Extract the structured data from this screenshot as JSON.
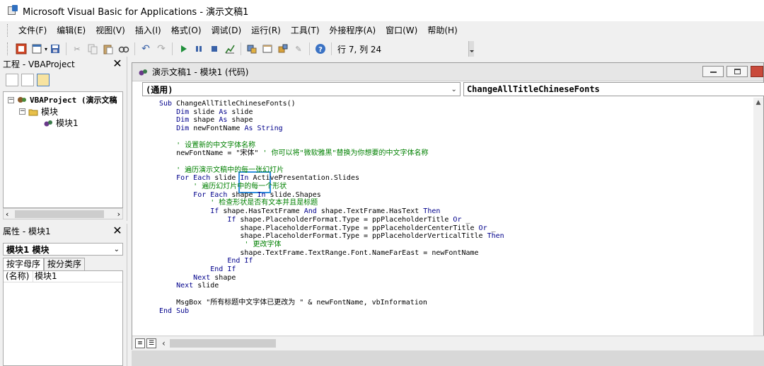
{
  "window": {
    "title": "Microsoft Visual Basic for Applications - 演示文稿1"
  },
  "menu": [
    "文件(F)",
    "编辑(E)",
    "视图(V)",
    "插入(I)",
    "格式(O)",
    "调试(D)",
    "运行(R)",
    "工具(T)",
    "外接程序(A)",
    "窗口(W)",
    "帮助(H)"
  ],
  "toolbar": {
    "status": "行 7, 列 24"
  },
  "project_panel": {
    "title": "工程 - VBAProject",
    "root": "VBAProject (演示文稿",
    "folder": "模块",
    "module": "模块1"
  },
  "properties_panel": {
    "title": "属性 - 模块1",
    "object": "模块1 模块",
    "tabs": [
      "按字母序",
      "按分类序"
    ],
    "rows": [
      {
        "key": "(名称)",
        "value": "模块1"
      }
    ]
  },
  "code_window": {
    "title": "演示文稿1 - 模块1 (代码)",
    "object_dropdown": "(通用)",
    "proc_dropdown": "ChangeAllTitleChineseFonts",
    "lines": [
      [
        [
          "kw",
          "Sub "
        ],
        [
          "t",
          "ChangeAllTitleChineseFonts()"
        ]
      ],
      [
        [
          "t",
          "    "
        ],
        [
          "kw",
          "Dim "
        ],
        [
          "t",
          "slide "
        ],
        [
          "kw",
          "As "
        ],
        [
          "t",
          "slide"
        ]
      ],
      [
        [
          "t",
          "    "
        ],
        [
          "kw",
          "Dim "
        ],
        [
          "t",
          "shape "
        ],
        [
          "kw",
          "As "
        ],
        [
          "t",
          "shape"
        ]
      ],
      [
        [
          "t",
          "    "
        ],
        [
          "kw",
          "Dim "
        ],
        [
          "t",
          "newFontName "
        ],
        [
          "kw",
          "As String"
        ]
      ],
      [
        [
          "t",
          ""
        ]
      ],
      [
        [
          "cm",
          "    ' 设置新的中文字体名称"
        ]
      ],
      [
        [
          "t",
          "    newFontName = \"宋体\" "
        ],
        [
          "cm",
          "' 你可以将\"微软雅黑\"替换为你想要的中文字体名称"
        ]
      ],
      [
        [
          "t",
          ""
        ]
      ],
      [
        [
          "cm",
          "    ' 遍历演示文稿中的每一张幻灯片"
        ]
      ],
      [
        [
          "t",
          "    "
        ],
        [
          "kw",
          "For Each "
        ],
        [
          "t",
          "slide "
        ],
        [
          "kw",
          "In "
        ],
        [
          "t",
          "ActivePresentation.Slides"
        ]
      ],
      [
        [
          "cm",
          "        ' 遍历幻灯片中的每一个形状"
        ]
      ],
      [
        [
          "t",
          "        "
        ],
        [
          "kw",
          "For Each "
        ],
        [
          "t",
          "shape "
        ],
        [
          "kw",
          "In "
        ],
        [
          "t",
          "slide.Shapes"
        ]
      ],
      [
        [
          "cm",
          "            ' 检查形状是否有文本并且是标题"
        ]
      ],
      [
        [
          "t",
          "            "
        ],
        [
          "kw",
          "If "
        ],
        [
          "t",
          "shape.HasTextFrame "
        ],
        [
          "kw",
          "And "
        ],
        [
          "t",
          "shape.TextFrame.HasText "
        ],
        [
          "kw",
          "Then"
        ]
      ],
      [
        [
          "t",
          "                "
        ],
        [
          "kw",
          "If "
        ],
        [
          "t",
          "shape.PlaceholderFormat.Type = ppPlaceholderTitle "
        ],
        [
          "kw",
          "Or "
        ],
        [
          "t",
          "_"
        ]
      ],
      [
        [
          "t",
          "                   shape.PlaceholderFormat.Type = ppPlaceholderCenterTitle "
        ],
        [
          "kw",
          "Or "
        ],
        [
          "t",
          "_"
        ]
      ],
      [
        [
          "t",
          "                   shape.PlaceholderFormat.Type = ppPlaceholderVerticalTitle "
        ],
        [
          "kw",
          "Then"
        ]
      ],
      [
        [
          "cm",
          "                    ' 更改字体"
        ]
      ],
      [
        [
          "t",
          "                   shape.TextFrame.TextRange.Font.NameFarEast = newFontName"
        ]
      ],
      [
        [
          "t",
          "                "
        ],
        [
          "kw",
          "End If"
        ]
      ],
      [
        [
          "t",
          "            "
        ],
        [
          "kw",
          "End If"
        ]
      ],
      [
        [
          "t",
          "        "
        ],
        [
          "kw",
          "Next "
        ],
        [
          "t",
          "shape"
        ]
      ],
      [
        [
          "t",
          "    "
        ],
        [
          "kw",
          "Next "
        ],
        [
          "t",
          "slide"
        ]
      ],
      [
        [
          "t",
          ""
        ]
      ],
      [
        [
          "t",
          "    MsgBox \"所有标题中文字体已更改为 \" & newFontName, vbInformation"
        ]
      ],
      [
        [
          "kw",
          "End Sub"
        ]
      ]
    ]
  }
}
